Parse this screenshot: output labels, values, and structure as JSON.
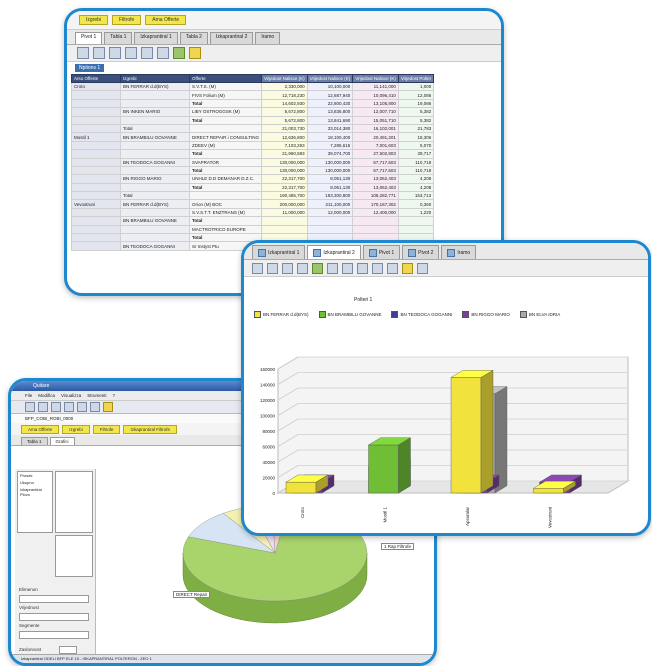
{
  "table_window": {
    "filter_chips": [
      "Izgrebi",
      "Filtrofe",
      "Ama Offerte"
    ],
    "tabs": [
      "Pivot 1",
      "Tabla 1",
      "Izkaprantiral 1",
      "Tabla 2",
      "Izkaprantiral 2",
      "Iramo"
    ],
    "selection_label": "Nptions 1",
    "headers": [
      "Arso Offerte",
      "Izgrebi",
      "Offerte",
      "Vrijedost Nalisce (K)",
      "Vrijedost Nalisce (K)",
      "Vrijedost Nalisce (K)",
      "Vrijedost Polter"
    ],
    "rows": [
      {
        "grp": "Croto",
        "sub": "BN FERRAR d.d(BYS)",
        "label": "S.V.T.S. (M)",
        "v": [
          "2,330,000",
          "10,100,000",
          "11,141,000",
          "1,000"
        ]
      },
      {
        "grp": "",
        "sub": "",
        "label": "FIVS Folium (M)",
        "v": [
          "12,718,230",
          "12,687,940",
          "10,096,410",
          "12,086"
        ]
      },
      {
        "grp": "",
        "sub": "",
        "label": "Total",
        "v": [
          "14,602,930",
          "22,800,430",
          "13,105,800",
          "19,086"
        ]
      },
      {
        "grp": "",
        "sub": "BN INKEN MARIO",
        "label": "LIBY OSTROGGSK (M)",
        "v": [
          "5,672,800",
          "13,836,800",
          "12,007,710",
          "5,382"
        ]
      },
      {
        "grp": "",
        "sub": "",
        "label": "Total",
        "v": [
          "5,672,800",
          "13,841,690",
          "15,051,710",
          "5,382"
        ]
      },
      {
        "grp": "",
        "sub": "Total",
        "label": "",
        "v": [
          "21,003,730",
          "33,014,380",
          "16,102,001",
          "21,783"
        ]
      },
      {
        "grp": "Mostil 1",
        "sub": "BN BRAMBILU GOVANNE",
        "label": "DIRECT REPAIR i CONSULTING",
        "v": [
          "12,636,800",
          "18,100,400",
          "20,491,201",
          "18,306"
        ]
      },
      {
        "grp": "",
        "sub": "",
        "label": "ZDEEV (M)",
        "v": [
          "7,103,293",
          "7,285,615",
          "7,001,603",
          "5,070"
        ]
      },
      {
        "grp": "",
        "sub": "",
        "label": "Total",
        "v": [
          "21,960,583",
          "39,074,700",
          "27,502,803",
          "39,717"
        ]
      },
      {
        "grp": "",
        "sub": "BN TEODOCA GOGANNI",
        "label": "SVAPRATOR",
        "v": [
          "130,000,000",
          "130,000,000",
          "67,717,603",
          "110,718"
        ]
      },
      {
        "grp": "",
        "sub": "",
        "label": "Total",
        "v": [
          "130,000,000",
          "130,000,000",
          "67,717,603",
          "110,718"
        ]
      },
      {
        "grp": "",
        "sub": "BN RIGGO MARIO",
        "label": "UNHLE D.D DEMANAR D.Z.C.",
        "v": [
          "22,317,700",
          "8,051,130",
          "13,062,403",
          "4,208"
        ]
      },
      {
        "grp": "",
        "sub": "",
        "label": "Total",
        "v": [
          "22,317,700",
          "8,051,130",
          "13,062,403",
          "4,208"
        ]
      },
      {
        "grp": "",
        "sub": "Total",
        "label": "",
        "v": [
          "190,485,700",
          "193,300,800",
          "108,282,771",
          "153,713"
        ]
      },
      {
        "grp": "Vevostruni",
        "sub": "BN FERRAR d.d(BYS)",
        "label": "Orion (M) BOC",
        "v": [
          "200,000,000",
          "211,100,000",
          "170,167,302",
          "0,360"
        ]
      },
      {
        "grp": "",
        "sub": "",
        "label": "S.V.S.T.T. ENZTRANS (M)",
        "v": [
          "11,000,000",
          "12,000,000",
          "12,400,000",
          "1,220"
        ]
      },
      {
        "grp": "",
        "sub": "BN BRAMBILU GOVANNE",
        "label": "Total",
        "v": [
          "",
          "",
          "",
          ""
        ]
      },
      {
        "grp": "",
        "sub": "",
        "label": "MACTROTRICO EUROPE",
        "v": [
          "",
          "",
          "",
          ""
        ]
      },
      {
        "grp": "",
        "sub": "",
        "label": "Total",
        "v": [
          "",
          "",
          "",
          ""
        ]
      },
      {
        "grp": "",
        "sub": "BN TEODOCA GOGANNI",
        "label": "Sr Instyst Ptu",
        "v": [
          "",
          "",
          "",
          ""
        ]
      }
    ]
  },
  "pie_window": {
    "title": "Quitare",
    "menu": [
      "File",
      "Modifica",
      "Visualizza",
      "Strumenti",
      "?"
    ],
    "path": "BFP_COBI_ROBI_0000",
    "chips": [
      "Ama Offerte",
      "Izgrebi",
      "Filtrofe",
      "Izkaprantiral Filtrofe"
    ],
    "tabs": [
      "Tabla 1",
      "Grafici"
    ],
    "left_labels": [
      "Elimenon",
      "Vrijednost",
      "Segmente",
      "Zaslonnost"
    ],
    "tree_items": [
      "Prosek",
      "Ukupno",
      "Izkaprantiral Plovo"
    ],
    "slice_labels": [
      "DIRECT Repair",
      "1 Rap Filtrofe"
    ],
    "status": "Izkaprantiral ODELI  BFP ELE 15  -  ISKAPRANTIRAL POLTERON - ZEO 1  ",
    "chart_data": {
      "type": "pie",
      "values": [
        78,
        10,
        5,
        4,
        3
      ],
      "colors": [
        "#a9d46b",
        "#d6e4f4",
        "#f3f0b3",
        "#e9ddf3",
        "#f7d3d3"
      ]
    }
  },
  "bar_window": {
    "tabs": [
      "Izkaprantiral 1",
      "Izkaprantiral 2",
      "Pivot 1",
      "Pivot 2",
      "Iramo"
    ],
    "chart_title": "Polteri 1",
    "chart_data": {
      "type": "bar",
      "categories": [
        "Croto",
        "Mostil 1",
        "Apsomlar",
        "Vevostruni"
      ],
      "series": [
        {
          "name": "BN FERRAR d.d(BYS)",
          "color": "#f2e33c",
          "values": [
            14000,
            0,
            149000,
            6000
          ]
        },
        {
          "name": "BN BRAMBILU GOVANNE",
          "color": "#6fbe36",
          "values": [
            0,
            62000,
            0,
            0
          ]
        },
        {
          "name": "BN TEODOCA GOGANNI",
          "color": "#3e3d9c",
          "values": [
            0,
            35000,
            0,
            0
          ]
        },
        {
          "name": "BN RIGGO MARIO",
          "color": "#7a3f9d",
          "values": [
            14000,
            0,
            14000,
            14000
          ]
        },
        {
          "name": "BN ELVA IDRIA",
          "color": "#a9aaa8",
          "values": [
            0,
            0,
            128000,
            0
          ]
        }
      ],
      "ylim": [
        0,
        160000
      ],
      "yticks": [
        "0",
        "20000",
        "40000",
        "60000",
        "80000",
        "100000",
        "120000",
        "140000",
        "160000"
      ]
    }
  }
}
